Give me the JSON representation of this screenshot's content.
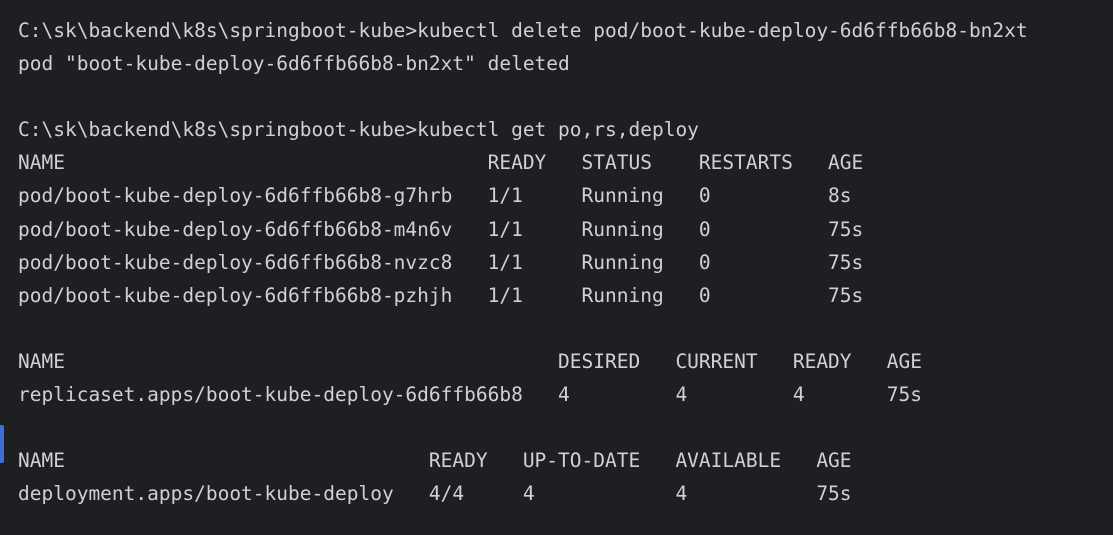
{
  "terminal": {
    "colors": {
      "background": "#1e1f22",
      "text": "#cfd1d5",
      "gutter_marker": "#3d6fd6"
    },
    "lines": [
      "C:\\sk\\backend\\k8s\\springboot-kube>kubectl delete pod/boot-kube-deploy-6d6ffb66b8-bn2xt",
      "pod \"boot-kube-deploy-6d6ffb66b8-bn2xt\" deleted",
      "",
      "C:\\sk\\backend\\k8s\\springboot-kube>kubectl get po,rs,deploy",
      "NAME                                    READY   STATUS    RESTARTS   AGE",
      "pod/boot-kube-deploy-6d6ffb66b8-g7hrb   1/1     Running   0          8s",
      "pod/boot-kube-deploy-6d6ffb66b8-m4n6v   1/1     Running   0          75s",
      "pod/boot-kube-deploy-6d6ffb66b8-nvzc8   1/1     Running   0          75s",
      "pod/boot-kube-deploy-6d6ffb66b8-pzhjh   1/1     Running   0          75s",
      "",
      "NAME                                          DESIRED   CURRENT   READY   AGE",
      "replicaset.apps/boot-kube-deploy-6d6ffb66b8   4         4         4       75s",
      "",
      "NAME                               READY   UP-TO-DATE   AVAILABLE   AGE",
      "deployment.apps/boot-kube-deploy   4/4     4            4           75s"
    ]
  }
}
